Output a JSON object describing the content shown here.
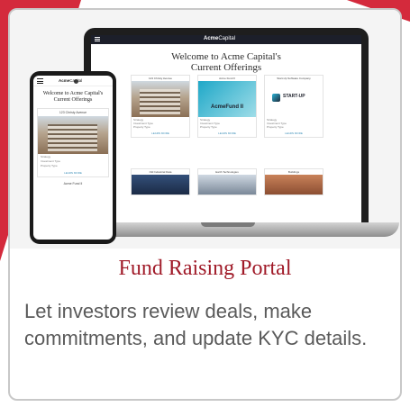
{
  "laptop": {
    "brand_bold": "Acme",
    "brand_rest": "Capital",
    "title_line1": "Welcome to Acme Capital's",
    "title_line2": "Current Offerings",
    "cards": [
      {
        "name": "123 Christy Avenue",
        "learn": "LEARN MORE"
      },
      {
        "name": "Acme Fund II",
        "image_label": "AcmeFund II",
        "learn": "LEARN MORE"
      },
      {
        "name": "Start-Up Software Company",
        "image_label": "START-UP",
        "learn": "LEARN MORE"
      }
    ],
    "meta_labels": [
      "Strategy",
      "Investment Type",
      "Property Type"
    ],
    "lower_cards": [
      "Old Industrial Data",
      "Earth Technologies",
      "Buildings"
    ]
  },
  "phone": {
    "brand_bold": "Acme",
    "brand_rest": "Capital",
    "title_line1": "Welcome to Acme Capital's",
    "title_line2": "Current Offerings",
    "card_name": "123 Christy Avenue",
    "meta_labels": [
      "Strategy",
      "Investment Type",
      "Property Type"
    ],
    "learn": "LEARN MORE",
    "next_card": "Acme Fund II"
  },
  "portal": {
    "title": "Fund Raising Portal",
    "description": "Let investors review deals, make commitments, and update KYC details."
  },
  "colors": {
    "accent": "#d42a3c",
    "title": "#a01a28",
    "text": "#5a5a5a"
  }
}
